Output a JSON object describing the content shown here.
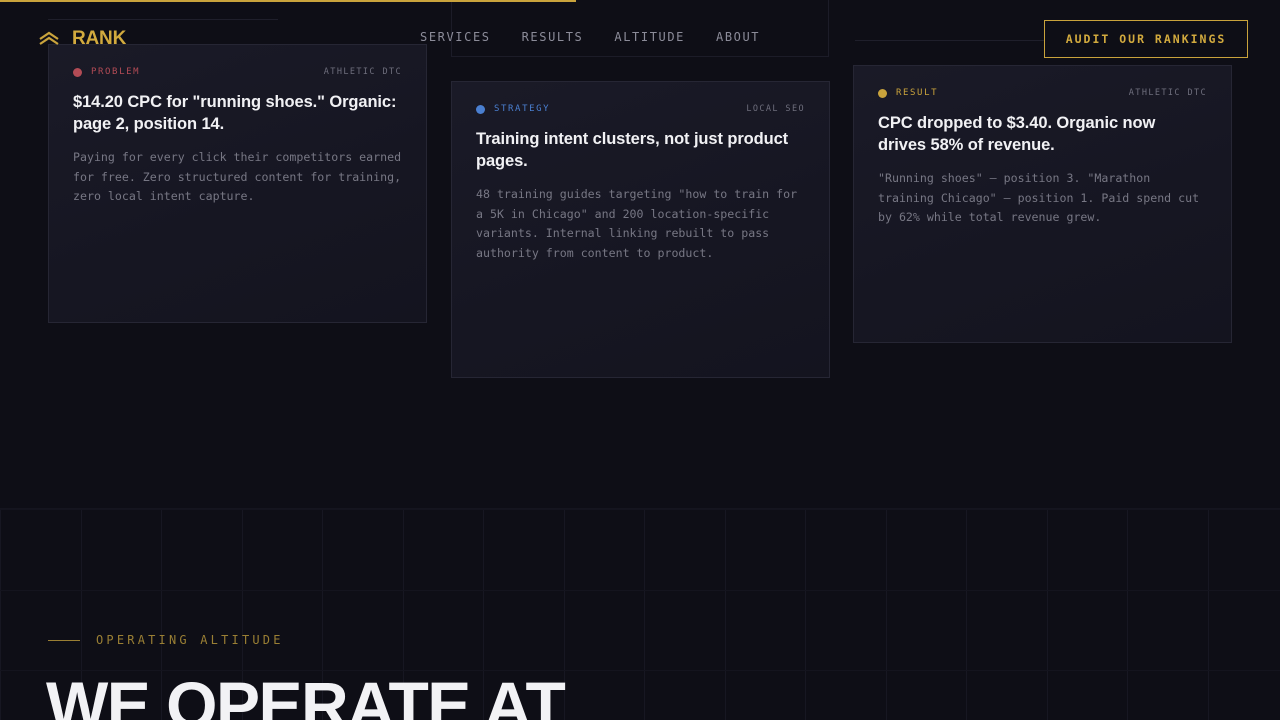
{
  "progress": {
    "fraction": 0.45
  },
  "brand": {
    "name": "RANK",
    "logo_icon": "chevron-stack-icon",
    "accent": "#c9a33c"
  },
  "nav": {
    "items": [
      {
        "label": "SERVICES"
      },
      {
        "label": "RESULTS"
      },
      {
        "label": "ALTITUDE"
      },
      {
        "label": "ABOUT"
      }
    ]
  },
  "cta": {
    "label": "AUDIT OUR RANKINGS"
  },
  "cards": [
    {
      "tag": "PROBLEM",
      "tag_color": "#b24b55",
      "client": "ATHLETIC DTC",
      "title": "$14.20 CPC for \"running shoes.\" Organic: page 2, position 14.",
      "body": "Paying for every click their competitors earned for free. Zero structured content for training, zero local intent capture."
    },
    {
      "tag": "STRATEGY",
      "tag_color": "#4a7fd0",
      "client": "LOCAL SEO",
      "title": "Training intent clusters, not just product pages.",
      "body": "48 training guides targeting \"how to train for a 5K in Chicago\" and 200 location-specific variants. Internal linking rebuilt to pass authority from content to product."
    },
    {
      "tag": "RESULT",
      "tag_color": "#c9a33c",
      "client": "ATHLETIC DTC",
      "title": "CPC dropped to $3.40. Organic now drives 58% of revenue.",
      "body": "\"Running shoes\" — position 3. \"Marathon training Chicago\" — position 1. Paid spend cut by 62% while total revenue grew."
    }
  ],
  "section": {
    "eyebrow": "OPERATING ALTITUDE",
    "headline": "WE OPERATE AT"
  }
}
